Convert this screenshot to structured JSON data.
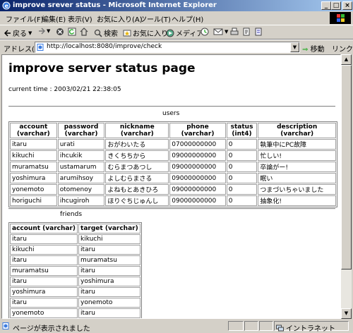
{
  "window": {
    "title": "improve srever status - Microsoft Internet Explorer"
  },
  "menu": [
    "ファイル(F)",
    "編集(E)",
    "表示(V)",
    "お気に入り(A)",
    "ツール(T)",
    "ヘルプ(H)"
  ],
  "toolbar": {
    "back_label": "戻る",
    "search_label": "検索",
    "favorites_label": "お気に入り",
    "media_label": "メディア"
  },
  "address": {
    "label": "アドレス(D)",
    "url": "http://localhost:8080/improve/check",
    "go_label": "移動",
    "links_label": "リンク"
  },
  "page": {
    "heading": "improve server status page",
    "current_time_label": "current time : ",
    "current_time": "2003/02/21 22:38:05"
  },
  "users": {
    "caption": "users",
    "headers": [
      [
        "account",
        "(varchar)"
      ],
      [
        "password",
        "(varchar)"
      ],
      [
        "nickname",
        "(varchar)"
      ],
      [
        "phone",
        "(varchar)"
      ],
      [
        "status",
        "(int4)"
      ],
      [
        "description",
        "(varchar)"
      ]
    ],
    "rows": [
      [
        "itaru",
        "urati",
        "おがわいたる",
        "07000000000",
        "0",
        "執筆中にPC故障"
      ],
      [
        "kikuchi",
        "ihcukik",
        "きくちちから",
        "09000000000",
        "0",
        "忙しい!"
      ],
      [
        "muramatsu",
        "ustamarum",
        "むらまつあつし",
        "09000000000",
        "0",
        "卒論がー!"
      ],
      [
        "yoshimura",
        "arumihsoy",
        "よしむらまさる",
        "09000000000",
        "0",
        "眠い"
      ],
      [
        "yonemoto",
        "otomenoy",
        "よねもとあきひろ",
        "09000000000",
        "0",
        "つまづいちゃいました"
      ],
      [
        "horiguchi",
        "ihcugiroh",
        "ほりぐちじゅんし",
        "09000000000",
        "0",
        "抽象化!"
      ]
    ]
  },
  "friends": {
    "caption": "friends",
    "headers": [
      "account (varchar)",
      "target (varchar)"
    ],
    "rows": [
      [
        "itaru",
        "kikuchi"
      ],
      [
        "kikuchi",
        "itaru"
      ],
      [
        "itaru",
        "muramatsu"
      ],
      [
        "muramatsu",
        "itaru"
      ],
      [
        "itaru",
        "yoshimura"
      ],
      [
        "yoshimura",
        "itaru"
      ],
      [
        "itaru",
        "yonemoto"
      ],
      [
        "yonemoto",
        "itaru"
      ]
    ]
  },
  "status": {
    "text": "ページが表示されました",
    "zone": "イントラネット"
  }
}
